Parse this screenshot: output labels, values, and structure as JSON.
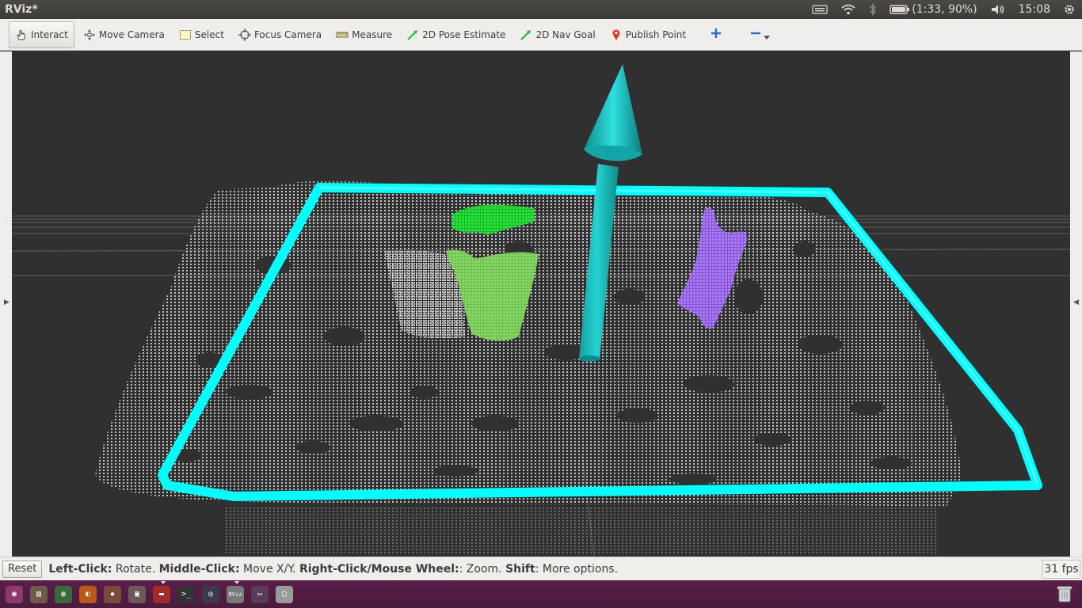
{
  "window": {
    "title": "RViz*"
  },
  "top_panel": {
    "battery_text": "(1:33, 90%)",
    "clock": "15:08",
    "icons": [
      "keyboard-icon",
      "wifi-icon",
      "bluetooth-icon",
      "battery-icon",
      "volume-icon",
      "gear-icon"
    ]
  },
  "toolbar": {
    "tools": [
      {
        "label": "Interact",
        "icon": "hand-icon",
        "active": true
      },
      {
        "label": "Move Camera",
        "icon": "move-camera-icon",
        "active": false
      },
      {
        "label": "Select",
        "icon": "select-icon",
        "active": false
      },
      {
        "label": "Focus Camera",
        "icon": "focus-camera-icon",
        "active": false
      },
      {
        "label": "Measure",
        "icon": "ruler-icon",
        "active": false
      },
      {
        "label": "2D Pose Estimate",
        "icon": "pose-arrow-icon",
        "active": false
      },
      {
        "label": "2D Nav Goal",
        "icon": "nav-arrow-icon",
        "active": false
      },
      {
        "label": "Publish Point",
        "icon": "map-pin-icon",
        "active": false
      }
    ],
    "extra_icons": [
      "add-tool-icon",
      "remove-tool-icon",
      "dropdown-arrow-icon"
    ]
  },
  "viewport": {
    "colors": {
      "background": "#303030",
      "frame": "#00ffff",
      "arrow": "#1fc9c9",
      "cluster_green_top": "#22dd33",
      "cluster_green": "#77cc55",
      "cluster_purple": "#9a66ee",
      "points": "#cfcfcf"
    }
  },
  "statusbar": {
    "reset_label": "Reset",
    "help": {
      "k1": "Left-Click:",
      "v1": " Rotate. ",
      "k2": "Middle-Click:",
      "v2": " Move X/Y. ",
      "k3": "Right-Click/Mouse Wheel:",
      "v3": ": Zoom. ",
      "k4": "Shift",
      "v4": ": More options."
    },
    "fps": "31 fps"
  },
  "launcher": {
    "items": [
      {
        "name": "dash-home",
        "icon": "ubuntu-logo-icon",
        "color": "#8a3a6c",
        "glyph": "◉",
        "running": false
      },
      {
        "name": "files",
        "icon": "files-icon",
        "color": "#6e5a4a",
        "glyph": "▤",
        "running": false
      },
      {
        "name": "chrome",
        "icon": "chrome-icon",
        "color": "#3a6a3a",
        "glyph": "◍",
        "running": false
      },
      {
        "name": "firefox",
        "icon": "firefox-icon",
        "color": "#b85a1a",
        "glyph": "◐",
        "running": false
      },
      {
        "name": "settings",
        "icon": "system-settings-icon",
        "color": "#7a4a3a",
        "glyph": "✹",
        "running": false
      },
      {
        "name": "app-6",
        "icon": "app-icon",
        "color": "#6a5a5a",
        "glyph": "▣",
        "running": false
      },
      {
        "name": "app-7",
        "icon": "app-red-icon",
        "color": "#a22a2a",
        "glyph": "▬",
        "running": true
      },
      {
        "name": "terminal",
        "icon": "terminal-icon",
        "color": "#333333",
        "glyph": ">_",
        "running": false
      },
      {
        "name": "app-9",
        "icon": "globe-icon",
        "color": "#3a3a4a",
        "glyph": "◎",
        "running": false
      },
      {
        "name": "rviz",
        "icon": "rviz-icon",
        "color": "#7a7a7a",
        "glyph": "RViz",
        "running": true
      },
      {
        "name": "app-11",
        "icon": "window-icon",
        "color": "#5a3a5a",
        "glyph": "▭",
        "running": false
      },
      {
        "name": "app-12",
        "icon": "drive-icon",
        "color": "#9a9a9a",
        "glyph": "▢",
        "running": false
      }
    ],
    "trash_icon": "trash-icon"
  }
}
